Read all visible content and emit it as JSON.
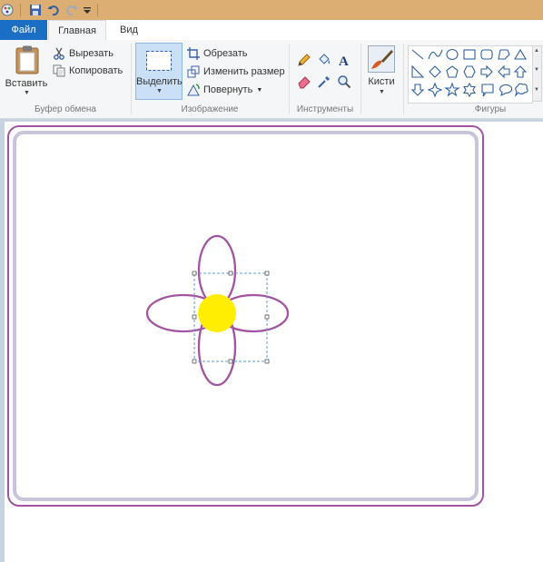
{
  "app": "Paint",
  "tabs": {
    "file": "Файл",
    "home": "Главная",
    "view": "Вид"
  },
  "clipboard": {
    "paste": "Вставить",
    "cut": "Вырезать",
    "copy": "Копировать",
    "group": "Буфер обмена"
  },
  "image": {
    "select": "Выделить",
    "crop": "Обрезать",
    "resize": "Изменить размер",
    "rotate": "Повернуть",
    "group": "Изображение"
  },
  "tools": {
    "group": "Инструменты",
    "items": [
      "pencil-icon",
      "fill-icon",
      "text-icon",
      "eraser-icon",
      "color-picker-icon",
      "magnifier-icon"
    ]
  },
  "brushes": {
    "label": "Кисти"
  },
  "shapes": {
    "group": "Фигуры",
    "items": [
      "line-shape",
      "curve-shape",
      "oval-shape",
      "rectangle-shape",
      "rounded-rectangle-shape",
      "polygon-shape",
      "triangle-shape",
      "right-triangle-shape",
      "diamond-shape",
      "pentagon-shape",
      "hexagon-shape",
      "right-arrow-shape",
      "left-arrow-shape",
      "up-arrow-shape",
      "down-arrow-shape",
      "four-point-star-shape",
      "five-point-star-shape",
      "six-point-star-shape",
      "rounded-callout-shape",
      "oval-callout-shape",
      "cloud-callout-shape"
    ]
  },
  "colors": {
    "file_tab": "#1a6fc4",
    "titlebar": "#dcae73",
    "outline": "#a254a2",
    "inner_frame": "#c8c4dc",
    "flower_center": "#ffee00",
    "selection": "#5b9bd5"
  }
}
